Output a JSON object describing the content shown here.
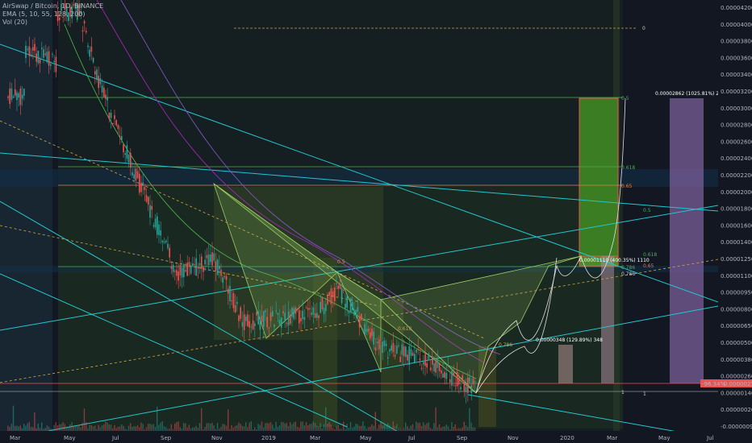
{
  "header": {
    "symbol_line": "AirSwap / Bitcoin, 1D, BINANCE",
    "ema_line": "EMA (5, 10, 55, 128, 200)",
    "vol_line": "Vol (20)"
  },
  "chart_data": {
    "type": "candlestick",
    "title": "AirSwap / Bitcoin, 1D, BINANCE",
    "x_ticks": [
      "Mar",
      "May",
      "Jul",
      "Sep",
      "Nov",
      "2019",
      "Mar",
      "May",
      "Jul",
      "Sep",
      "Nov",
      "2020",
      "Mar",
      "May",
      "Jul"
    ],
    "y_ticks": [
      "0.00004200",
      "0.00004000",
      "0.00003800",
      "0.00003600",
      "0.00003400",
      "0.00003200",
      "0.00003000",
      "0.00002800",
      "0.00002600",
      "0.00002400",
      "0.00002200",
      "0.00002000",
      "0.00001800",
      "0.00001600",
      "0.00001400",
      "0.00001250",
      "0.00001100",
      "0.00000950",
      "0.00000800",
      "0.00000650",
      "0.00000500",
      "0.00000380",
      "0.00000260",
      "0.00000140",
      "0.00000020",
      "-0.00000090"
    ],
    "current_price_label": "0.00000278",
    "current_pct_label": "-96.34%",
    "annotations": {
      "target_box": "0.00001110 (400.35%) 1110",
      "right_box": "0.00002862 (1025.81%) 2862",
      "small_box": "0.00000348 (129.89%) 348"
    },
    "fib_labels": [
      "0",
      "0.5",
      "0.618",
      "0.65",
      "0.786",
      "1",
      "0.5",
      "0.618",
      "0.65",
      "0.786",
      "1",
      "0.5",
      "0.618",
      "0.786"
    ],
    "series": [
      {
        "name": "EMA 5",
        "color": "#f23645"
      },
      {
        "name": "EMA 10",
        "color": "#ff9800"
      },
      {
        "name": "EMA 55",
        "color": "#4caf50"
      },
      {
        "name": "EMA 128",
        "color": "#9c27b0"
      },
      {
        "name": "EMA 200",
        "color": "#7e57c2"
      }
    ]
  },
  "colors": {
    "up": "#26a69a",
    "down": "#ef5350",
    "cyan": "#22c8d0",
    "fib_green": "#3d9a3d"
  }
}
